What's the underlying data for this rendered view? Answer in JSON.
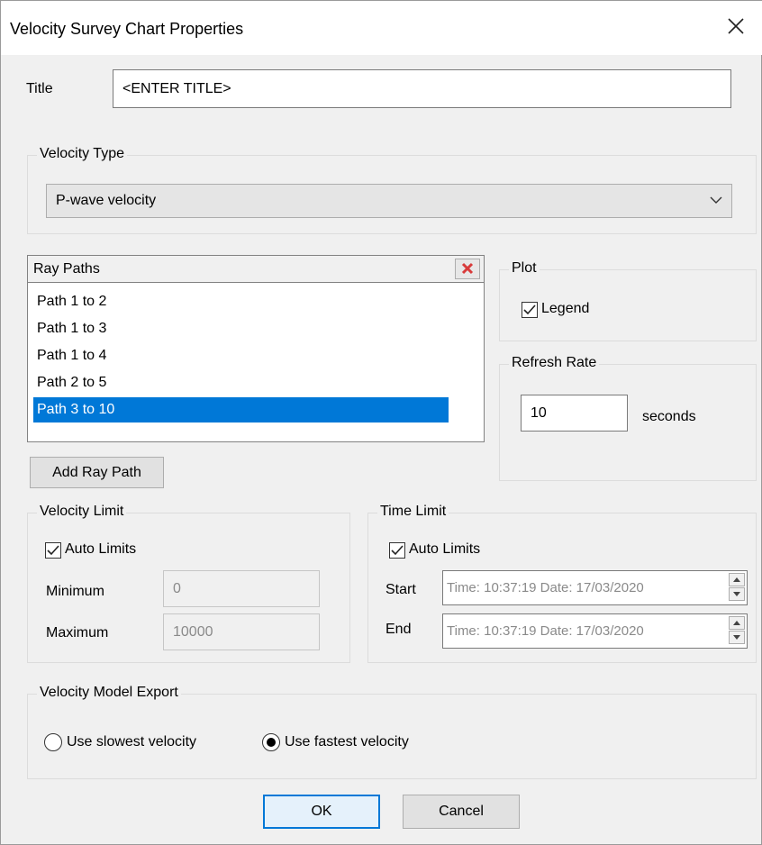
{
  "window": {
    "title": "Velocity Survey Chart Properties"
  },
  "title_field": {
    "label": "Title",
    "value": "<ENTER TITLE>"
  },
  "velocity_type": {
    "group_label": "Velocity Type",
    "selected": "P-wave velocity"
  },
  "ray_paths": {
    "header": "Ray Paths",
    "items": [
      "Path 1 to 2",
      "Path 1 to 3",
      "Path 1 to 4",
      "Path 2 to 5",
      "Path 3 to 10"
    ],
    "selected_index": 4,
    "add_button": "Add Ray Path"
  },
  "plot": {
    "group_label": "Plot",
    "legend_label": "Legend",
    "legend_checked": true
  },
  "refresh_rate": {
    "group_label": "Refresh Rate",
    "value": "10",
    "unit": "seconds"
  },
  "velocity_limit": {
    "group_label": "Velocity Limit",
    "auto_label": "Auto Limits",
    "auto_checked": true,
    "min_label": "Minimum",
    "min_value": "0",
    "max_label": "Maximum",
    "max_value": "10000"
  },
  "time_limit": {
    "group_label": "Time Limit",
    "auto_label": "Auto Limits",
    "auto_checked": true,
    "start_label": "Start",
    "start_value": "Time: 10:37:19  Date: 17/03/2020",
    "end_label": "End",
    "end_value": "Time: 10:37:19  Date: 17/03/2020"
  },
  "export": {
    "group_label": "Velocity Model Export",
    "option_slowest": "Use slowest velocity",
    "option_fastest": "Use fastest velocity",
    "selected": "fastest"
  },
  "buttons": {
    "ok": "OK",
    "cancel": "Cancel"
  },
  "colors": {
    "selection": "#0078d7",
    "remove_icon": "#d83b3b"
  }
}
